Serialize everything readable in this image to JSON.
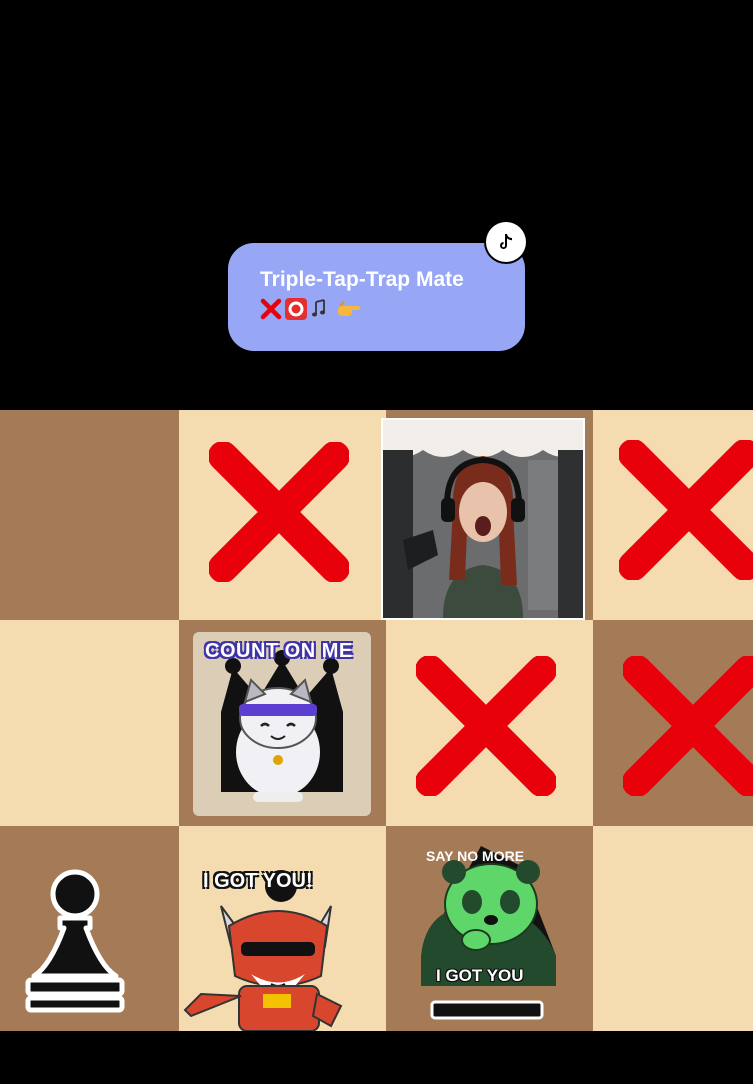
{
  "caption": {
    "title": "Triple-Tap-Trap Mate",
    "emoji_icons": [
      "cross-mark-icon",
      "o-button-icon",
      "musical-notes-icon",
      "pointing-right-icon"
    ]
  },
  "board": {
    "squares": [
      {
        "row": 0,
        "col": 0,
        "color": "dark",
        "content": "empty"
      },
      {
        "row": 0,
        "col": 1,
        "color": "light",
        "content": "x-mark"
      },
      {
        "row": 0,
        "col": 2,
        "color": "dark",
        "content": "webcam"
      },
      {
        "row": 0,
        "col": 3,
        "color": "light",
        "content": "x-mark"
      },
      {
        "row": 1,
        "col": 0,
        "color": "light",
        "content": "empty"
      },
      {
        "row": 1,
        "col": 1,
        "color": "dark",
        "content": "cat-sticker"
      },
      {
        "row": 1,
        "col": 2,
        "color": "light",
        "content": "x-mark"
      },
      {
        "row": 1,
        "col": 3,
        "color": "dark",
        "content": "x-mark"
      },
      {
        "row": 2,
        "col": 0,
        "color": "dark",
        "content": "pawn"
      },
      {
        "row": 2,
        "col": 1,
        "color": "light",
        "content": "fox-sticker"
      },
      {
        "row": 2,
        "col": 2,
        "color": "dark",
        "content": "panda-sticker"
      },
      {
        "row": 2,
        "col": 3,
        "color": "light",
        "content": "empty"
      }
    ],
    "colors": {
      "dark": "#a57b57",
      "light": "#f5dbb0",
      "x_mark": "#e8000b"
    }
  },
  "stickers": {
    "cat": {
      "text": "COUNT ON ME"
    },
    "fox": {
      "text": "I GOT YOU!"
    },
    "panda": {
      "top_text": "SAY NO MORE",
      "bottom_text": "I GOT YOU"
    }
  }
}
